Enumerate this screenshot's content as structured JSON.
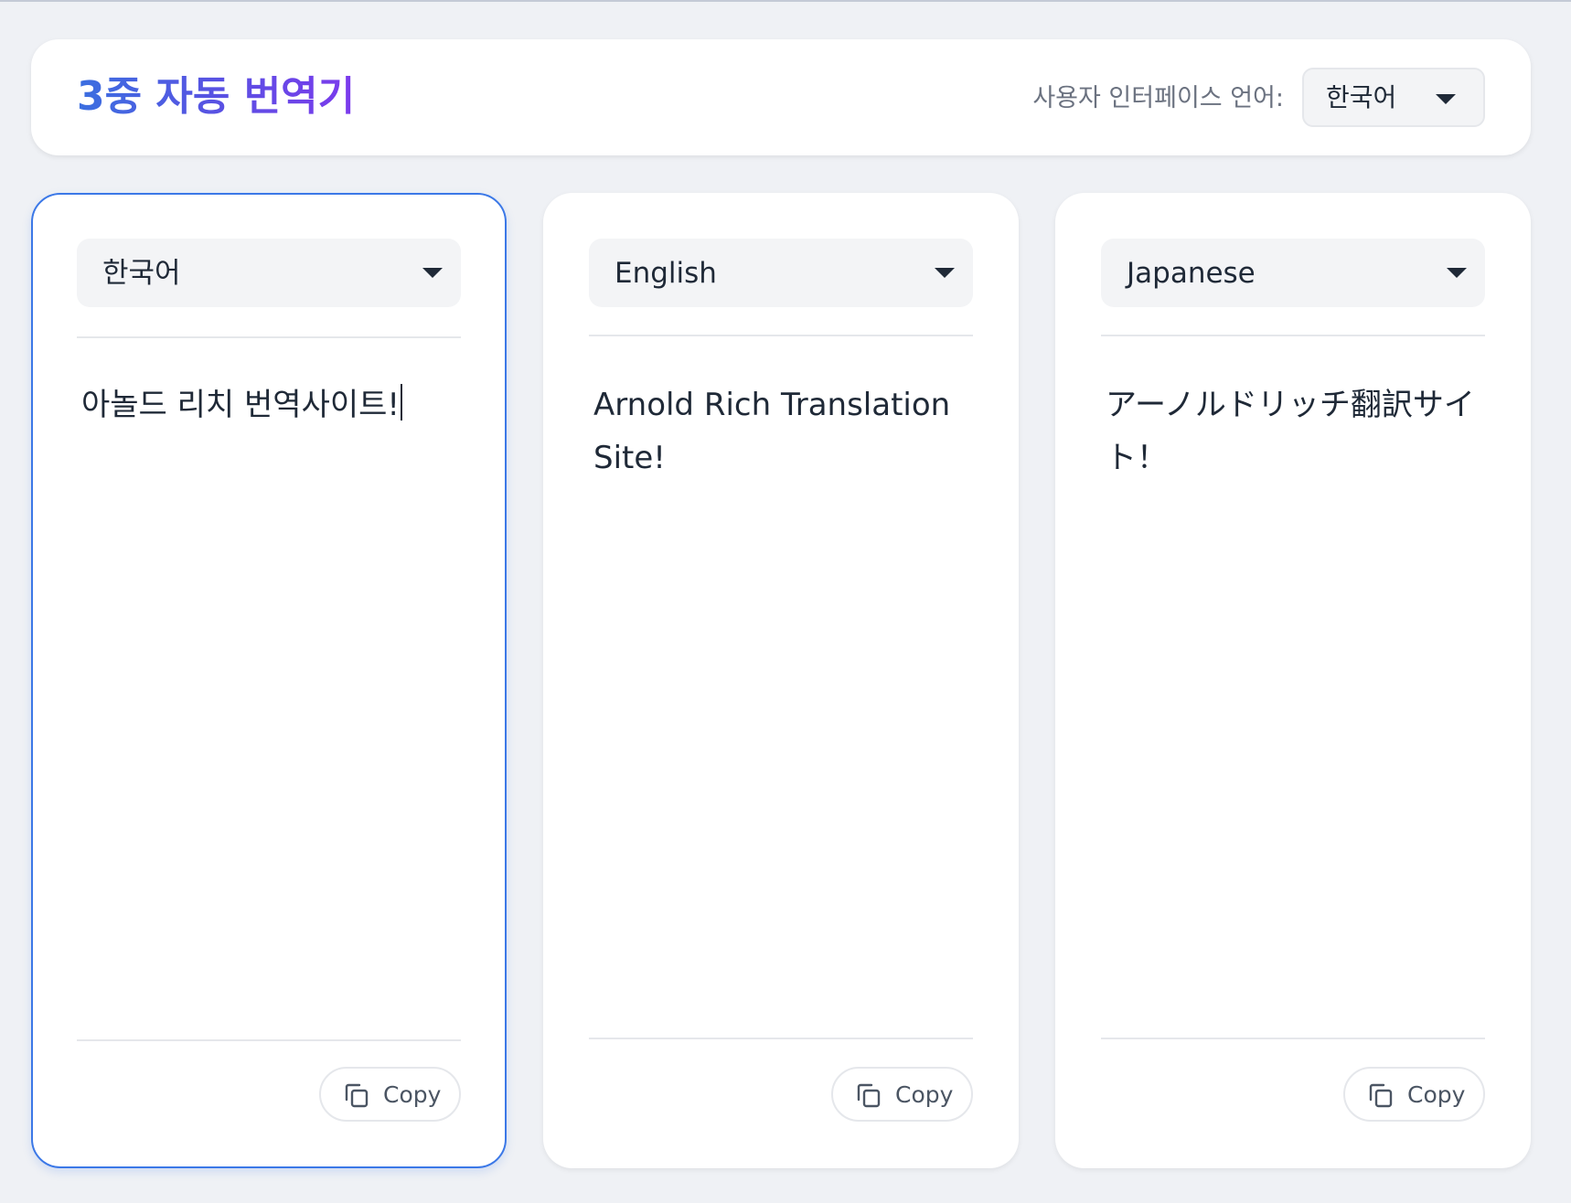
{
  "header": {
    "title": "3중 자동 번역기",
    "ui_language_label": "사용자 인터페이스 언어:",
    "ui_language_value": "한국어"
  },
  "panels": [
    {
      "language": "한국어",
      "text": "아놀드 리치 번역사이트!",
      "copy_label": "Copy"
    },
    {
      "language": "English",
      "text": "Arnold Rich Translation Site!",
      "copy_label": "Copy"
    },
    {
      "language": "Japanese",
      "text": "アーノルドリッチ翻訳サイト！",
      "copy_label": "Copy"
    }
  ],
  "colors": {
    "accent": "#3b78e7",
    "title_gradient_start": "#3b6fe0",
    "title_gradient_end": "#7c3aed",
    "background": "#eff1f5"
  },
  "icons": {
    "dropdown": "chevron-down-icon",
    "copy": "copy-icon"
  }
}
